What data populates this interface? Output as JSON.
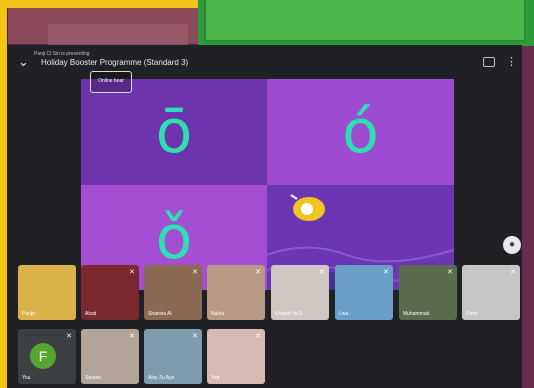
{
  "meeting": {
    "presenter_text": "Panji.Cl Sin is presenting",
    "title": "Holiday Booster Programme (Standard 3)",
    "badge_text": "Online bear",
    "slide_letters": [
      "ō",
      "ó",
      "ǒ"
    ]
  },
  "participants": [
    {
      "name": "Panjiy"
    },
    {
      "name": "Aizat"
    },
    {
      "name": "Shanisa Ai"
    },
    {
      "name": "Naiha"
    },
    {
      "name": "Khaled Ye.D"
    },
    {
      "name": "Lwa"
    },
    {
      "name": "Muhammad"
    },
    {
      "name": "Pano"
    },
    {
      "name": "You",
      "initial": "F"
    },
    {
      "name": "Serban"
    },
    {
      "name": "Aisy Zu Aye"
    },
    {
      "name": "Yee"
    }
  ],
  "colors": {
    "tile_bg": "#3c4043",
    "slide_purple": "#6d34ad",
    "letter_teal": "#2de0b2"
  }
}
